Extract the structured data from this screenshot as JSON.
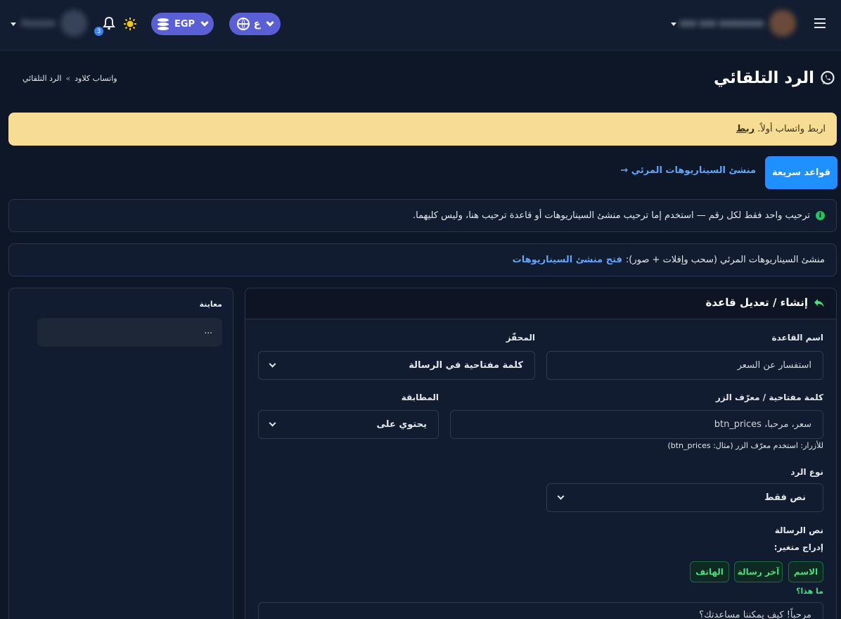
{
  "topbar": {
    "currency": "EGP",
    "language": "ع",
    "notification_count": "3",
    "user_name": "Aaaaaa",
    "account_name": "aaa aaa aaaaaaaa"
  },
  "page": {
    "title": "الرد التلقائي",
    "breadcrumb": [
      "واتساب كلاود",
      "الرد التلقائي"
    ],
    "breadcrumb_sep": "»"
  },
  "warning": {
    "text": "اربط واتساب أولاً.",
    "link": "ربط"
  },
  "tabs": {
    "quick_rules": "قواعد سريعة",
    "visual_builder": "منشئ السيناريوهات المرئي →"
  },
  "info": {
    "text": "ترحيب واحد فقط لكل رقم — استخدم إما ترحيب منشئ السيناريوهات أو قاعدة ترحيب هنا، وليس كليهما."
  },
  "builder_banner": {
    "text": "منشئ السيناريوهات المرئي (سحب وإفلات + صور):",
    "link": "فتح منشئ السيناريوهات"
  },
  "preview": {
    "title": "معاينة",
    "bubble": "..."
  },
  "form": {
    "title": "إنشاء / تعديل قاعدة",
    "rule_name_label": "اسم القاعدة",
    "rule_name_value": "استفسار عن السعر",
    "trigger_label": "المحفّز",
    "trigger_value": "كلمة مفتاحية في الرسالة",
    "keyword_label": "كلمة مفتاحية / معرّف الزر",
    "keyword_value": "سعر، مرحبا، btn_prices",
    "keyword_hint": "للأزرار: استخدم معرّف الزر (مثال: btn_prices)",
    "match_label": "المطابقة",
    "match_value": "يحتوي على",
    "reply_type_label": "نوع الرد",
    "reply_type_value": "نص فقط",
    "message_label": "نص الرسالة",
    "insert_var_label": "إدراج متغير:",
    "variables": [
      "الاسم",
      "آخر رسالة",
      "الهاتف"
    ],
    "whats_this": "ما هذا؟",
    "message_value": "مرحباً! كيف يمكننا مساعدتك؟"
  },
  "colors": {
    "background": "#0e1728",
    "accent": "#5b5fd6",
    "warning_bg": "#f7dc93",
    "primary_button": "#1e90ff",
    "link": "#60a5fa",
    "chip_green": "#4ade80"
  }
}
